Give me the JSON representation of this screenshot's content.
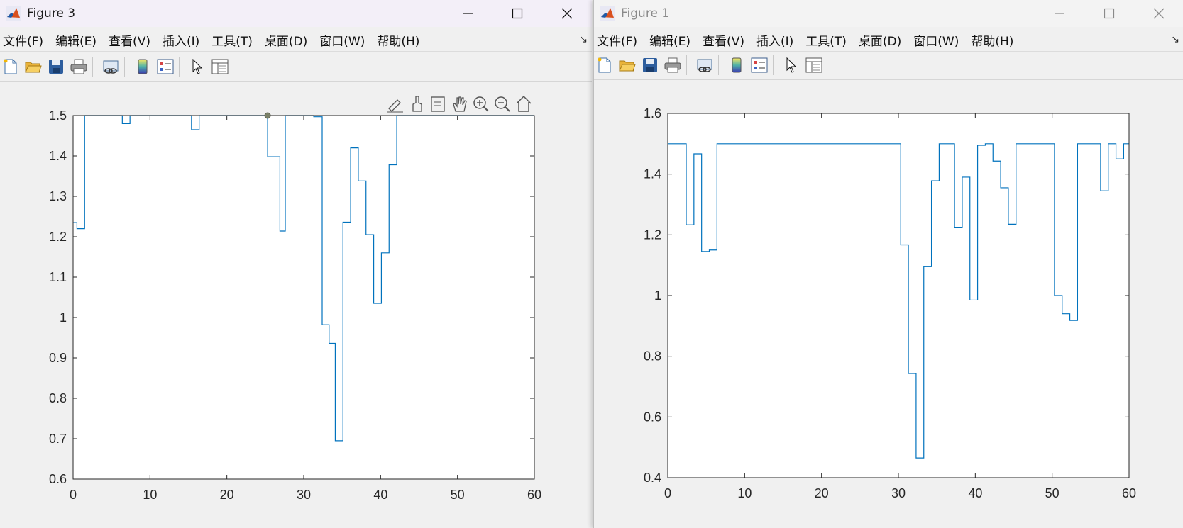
{
  "figure3": {
    "title": "Figure 3",
    "menu": [
      "文件(F)",
      "编辑(E)",
      "查看(V)",
      "插入(I)",
      "工具(T)",
      "桌面(D)",
      "窗口(W)",
      "帮助(H)"
    ],
    "toolbar_icons": [
      "new-file-icon",
      "open-folder-icon",
      "save-icon",
      "print-icon",
      "link-icon",
      "colorbar-icon",
      "legend-icon",
      "pointer-icon",
      "property-inspector-icon"
    ],
    "axes_toolbar_icons": [
      "brush-edit-icon",
      "data-brush-icon",
      "data-tips-icon",
      "pan-hand-icon",
      "zoom-in-icon",
      "zoom-out-icon",
      "home-icon"
    ]
  },
  "figure1": {
    "title": "Figure 1",
    "menu": [
      "文件(F)",
      "编辑(E)",
      "查看(V)",
      "插入(I)",
      "工具(T)",
      "桌面(D)",
      "窗口(W)",
      "帮助(H)"
    ],
    "toolbar_icons": [
      "new-file-icon",
      "open-folder-icon",
      "save-icon",
      "print-icon",
      "link-icon",
      "colorbar-icon",
      "legend-icon",
      "pointer-icon",
      "property-inspector-icon"
    ]
  },
  "colors": {
    "line": "#0072BD",
    "axes_bg": "#ffffff",
    "figure_bg": "#f0f0f0"
  },
  "chart_data": [
    {
      "type": "line",
      "title": "",
      "xlabel": "",
      "ylabel": "",
      "xlim": [
        0,
        60
      ],
      "ylim": [
        0.6,
        1.5
      ],
      "xticks": [
        0,
        10,
        20,
        30,
        40,
        50,
        60
      ],
      "yticks": [
        0.6,
        0.7,
        0.8,
        0.9,
        1,
        1.1,
        1.2,
        1.3,
        1.4,
        1.5
      ],
      "ytick_labels": [
        "0.6",
        "0.7",
        "0.8",
        "0.9",
        "1",
        "1.1",
        "1.2",
        "1.3",
        "1.4",
        "1.5"
      ],
      "datatip_marker": [
        25.3,
        1.5
      ],
      "steps": [
        [
          0,
          1.235
        ],
        [
          0.5,
          1.22
        ],
        [
          1.5,
          1.5
        ],
        [
          6.4,
          1.48
        ],
        [
          7.4,
          1.5
        ],
        [
          15.4,
          1.465
        ],
        [
          16.4,
          1.5
        ],
        [
          25.3,
          1.398
        ],
        [
          26.3,
          1.398
        ],
        [
          26.9,
          1.214
        ],
        [
          27.6,
          1.5
        ],
        [
          31.3,
          1.497
        ],
        [
          32.4,
          0.982
        ],
        [
          33.3,
          0.936
        ],
        [
          34.1,
          0.695
        ],
        [
          35.1,
          1.236
        ],
        [
          36.1,
          1.42
        ],
        [
          37.1,
          1.338
        ],
        [
          38.1,
          1.205
        ],
        [
          39.1,
          1.035
        ],
        [
          40.1,
          1.16
        ],
        [
          41.1,
          1.378
        ],
        [
          42.1,
          1.5
        ],
        [
          60,
          1.5
        ]
      ]
    },
    {
      "type": "line",
      "title": "",
      "xlabel": "",
      "ylabel": "",
      "xlim": [
        0,
        60
      ],
      "ylim": [
        0.4,
        1.6
      ],
      "xticks": [
        0,
        10,
        20,
        30,
        40,
        50,
        60
      ],
      "yticks": [
        0.4,
        0.6,
        0.8,
        1,
        1.2,
        1.4,
        1.6
      ],
      "ytick_labels": [
        "0.4",
        "0.6",
        "0.8",
        "1",
        "1.2",
        "1.4",
        "1.6"
      ],
      "steps": [
        [
          0,
          1.5
        ],
        [
          2.4,
          1.233
        ],
        [
          3.4,
          1.467
        ],
        [
          4.4,
          1.145
        ],
        [
          5.4,
          1.15
        ],
        [
          6.4,
          1.5
        ],
        [
          30.3,
          1.167
        ],
        [
          31.3,
          0.743
        ],
        [
          32.3,
          0.465
        ],
        [
          33.3,
          1.095
        ],
        [
          34.3,
          1.378
        ],
        [
          35.3,
          1.5
        ],
        [
          37.3,
          1.225
        ],
        [
          38.3,
          1.39
        ],
        [
          39.3,
          0.985
        ],
        [
          40.3,
          1.495
        ],
        [
          41.3,
          1.5
        ],
        [
          42.3,
          1.443
        ],
        [
          43.3,
          1.355
        ],
        [
          44.3,
          1.235
        ],
        [
          45.3,
          1.5
        ],
        [
          50.3,
          1.0
        ],
        [
          51.3,
          0.94
        ],
        [
          52.3,
          0.918
        ],
        [
          53.3,
          1.5
        ],
        [
          56.3,
          1.345
        ],
        [
          57.3,
          1.5
        ],
        [
          58.3,
          1.45
        ],
        [
          59.3,
          1.5
        ],
        [
          60,
          1.5
        ]
      ]
    }
  ]
}
